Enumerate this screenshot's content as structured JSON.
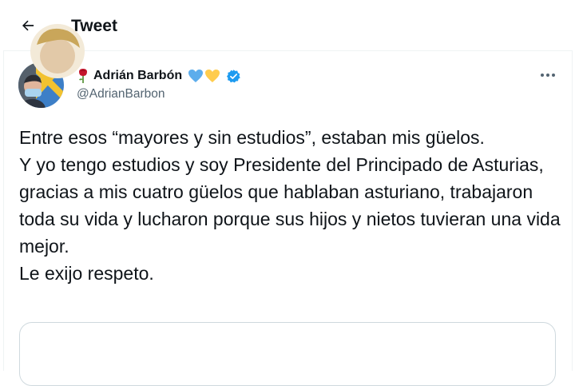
{
  "header": {
    "back_icon": "arrow-left-icon",
    "title": "Tweet"
  },
  "tweet": {
    "author": {
      "name": "Adrián Barbón",
      "handle": "@AdrianBarbon",
      "name_emoji": [
        "rose-icon",
        "blue-heart-icon",
        "yellow-heart-icon"
      ],
      "verified": true
    },
    "more_icon": "more-horizontal-icon",
    "text_lines": [
      "Entre esos “mayores y sin estudios”, estaban mis güelos.",
      "Y yo tengo estudios y soy Presidente del Principado de Asturias, gracias a mis cuatro güelos que hablaban asturiano, trabajaron toda su vida y lucharon porque sus hijos y nietos tuvieran una vida mejor.",
      "Le exijo respeto."
    ]
  },
  "colors": {
    "text": "#0f1419",
    "secondary": "#536471",
    "verified": "#1d9bf0",
    "border": "#cfd9de",
    "blue_heart": "#5dadec",
    "yellow_heart": "#ffcc4d"
  }
}
